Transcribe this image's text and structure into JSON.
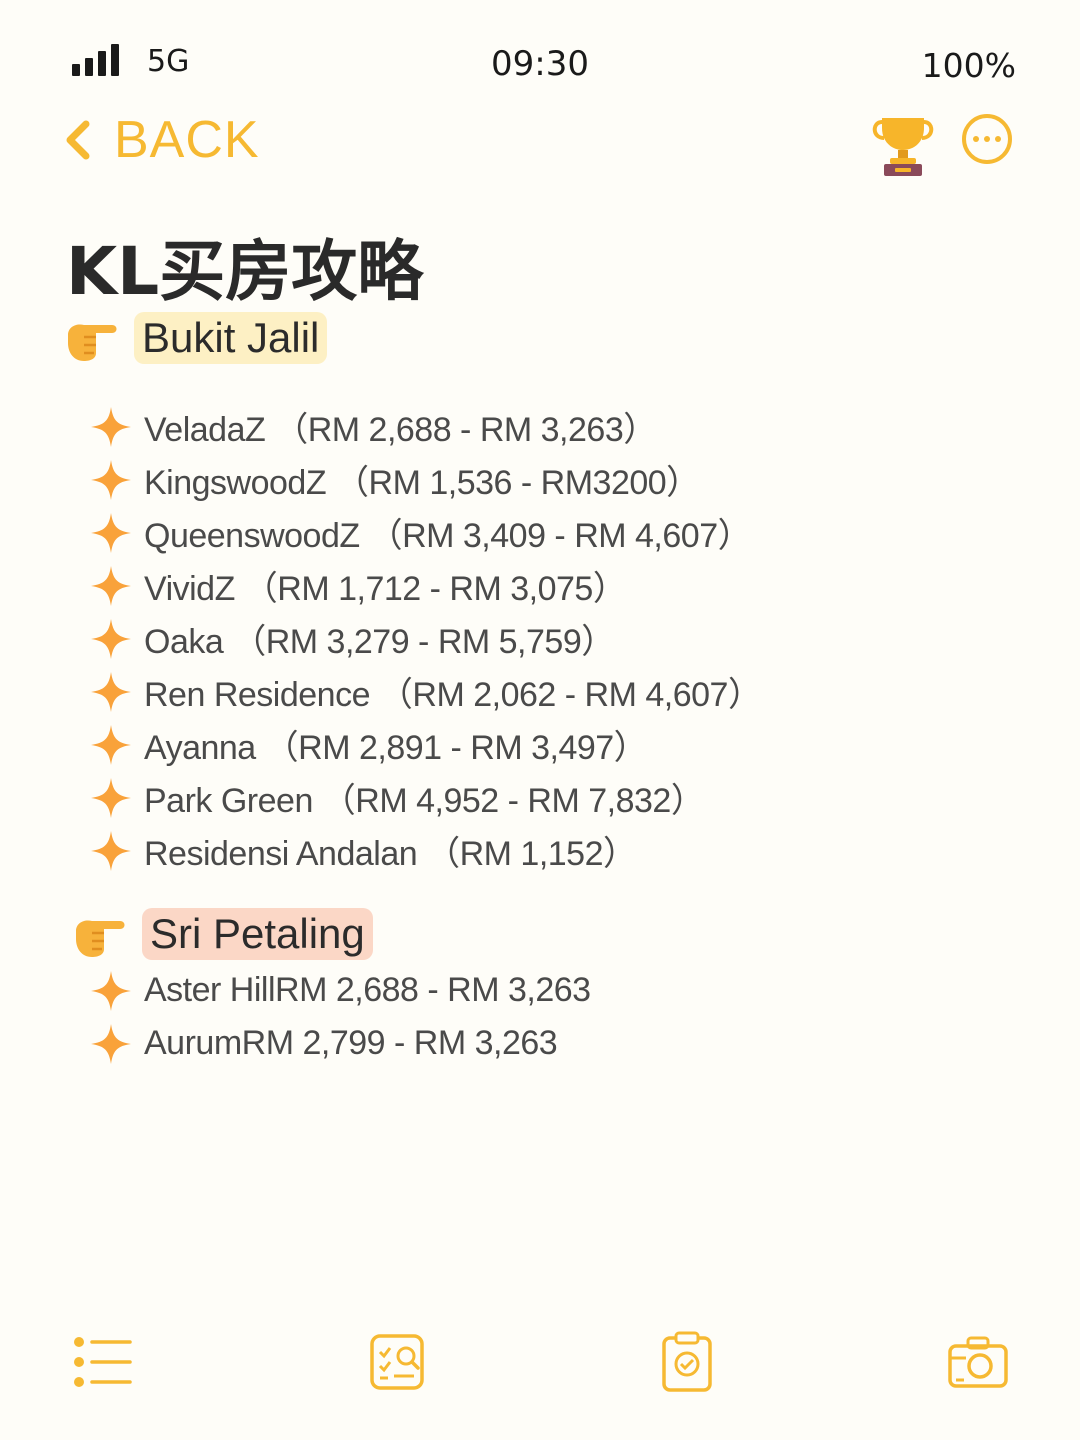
{
  "status_bar": {
    "network": "5G",
    "time": "09:30",
    "battery": "100%"
  },
  "nav": {
    "back_label": "BACK"
  },
  "page_title": "KL买房攻略",
  "sections": [
    {
      "name": "Bukit Jalil",
      "items": [
        "VeladaZ （RM 2,688 - RM 3,263）",
        "KingswoodZ （RM 1,536 - RM3200）",
        "QueenswoodZ （RM 3,409 - RM 4,607）",
        "VividZ （RM 1,712 - RM 3,075）",
        "Oaka （RM 3,279 - RM 5,759）",
        "Ren Residence （RM 2,062 - RM 4,607）",
        "Ayanna （RM 2,891 - RM 3,497）",
        "Park Green （RM 4,952 - RM 7,832）",
        "Residensi Andalan （RM 1,152）"
      ]
    },
    {
      "name": "Sri Petaling",
      "items": [
        "Aster HillRM 2,688 - RM 3,263",
        "AurumRM 2,799 - RM 3,263"
      ]
    }
  ],
  "colors": {
    "accent": "#f6b932",
    "background": "#fefdf8",
    "highlight_yellow": "#fdf0c4",
    "highlight_pink": "#fbd7c6",
    "sparkle": "#f9a23a"
  },
  "icons": {
    "nav": [
      "chevron-left-icon",
      "trophy-icon",
      "more-icon"
    ],
    "tabbar": [
      "list-icon",
      "checklist-search-icon",
      "clipboard-check-icon",
      "camera-icon"
    ]
  }
}
